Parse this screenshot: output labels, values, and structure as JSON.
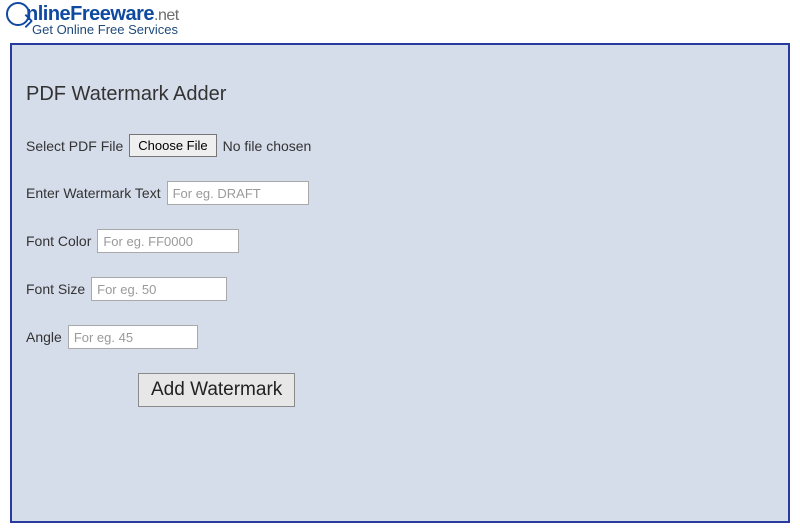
{
  "header": {
    "logo_main": "nlineFreeware",
    "logo_suffix": ".net",
    "tagline": "Get Online Free Services"
  },
  "page": {
    "title": "PDF Watermark Adder"
  },
  "form": {
    "file": {
      "label": "Select PDF File",
      "button": "Choose File",
      "status": "No file chosen"
    },
    "watermark": {
      "label": "Enter Watermark Text",
      "placeholder": "For eg. DRAFT"
    },
    "fontcolor": {
      "label": "Font Color",
      "placeholder": "For eg. FF0000"
    },
    "fontsize": {
      "label": "Font Size",
      "placeholder": "For eg. 50"
    },
    "angle": {
      "label": "Angle",
      "placeholder": "For eg. 45"
    },
    "submit": "Add Watermark"
  }
}
